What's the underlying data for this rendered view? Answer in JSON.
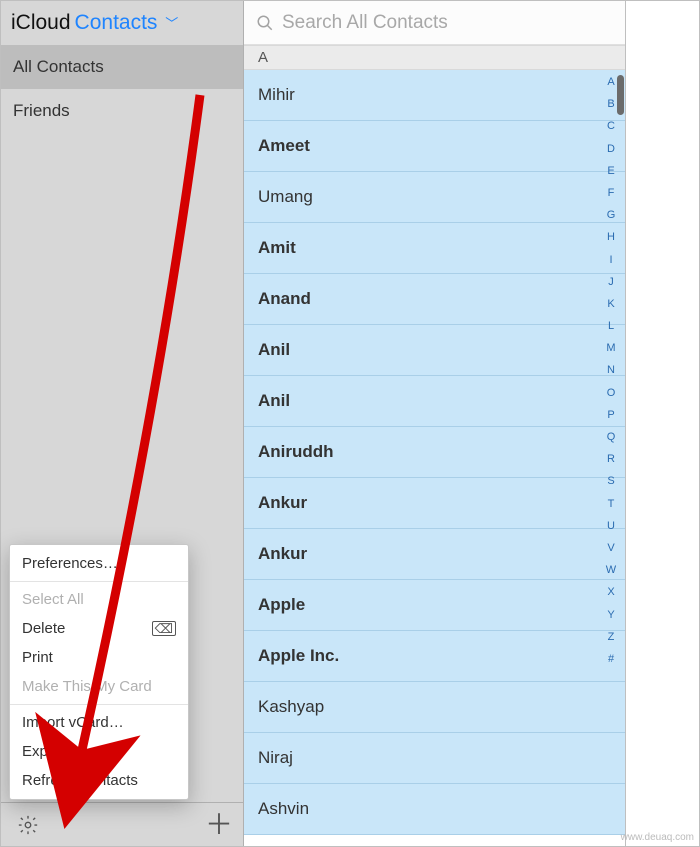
{
  "header": {
    "brand": "iCloud",
    "app_title": "Contacts"
  },
  "sidebar": {
    "groups": [
      {
        "label": "All Contacts",
        "active": true
      },
      {
        "label": "Friends",
        "active": false
      }
    ]
  },
  "search": {
    "placeholder": "Search All Contacts"
  },
  "section_letter": "A",
  "contacts": [
    {
      "name": "Mihir",
      "bold": false
    },
    {
      "name": "Ameet",
      "bold": true
    },
    {
      "name": "Umang",
      "bold": false
    },
    {
      "name": "Amit",
      "bold": true
    },
    {
      "name": "Anand",
      "bold": true
    },
    {
      "name": "Anil",
      "bold": true
    },
    {
      "name": "Anil",
      "bold": true
    },
    {
      "name": "Aniruddh",
      "bold": true
    },
    {
      "name": "Ankur",
      "bold": true
    },
    {
      "name": "Ankur",
      "bold": true
    },
    {
      "name": "Apple",
      "bold": true
    },
    {
      "name": "Apple Inc.",
      "bold": true
    },
    {
      "name": "Kashyap",
      "bold": false
    },
    {
      "name": "Niraj",
      "bold": false
    },
    {
      "name": "Ashvin",
      "bold": false
    }
  ],
  "index_letters": [
    "A",
    "B",
    "C",
    "D",
    "E",
    "F",
    "G",
    "H",
    "I",
    "J",
    "K",
    "L",
    "M",
    "N",
    "O",
    "P",
    "Q",
    "R",
    "S",
    "T",
    "U",
    "V",
    "W",
    "X",
    "Y",
    "Z",
    "#"
  ],
  "context_menu": {
    "preferences": "Preferences…",
    "select_all": "Select All",
    "delete": "Delete",
    "print": "Print",
    "make_my_card": "Make This My Card",
    "import_vcard": "Import vCard…",
    "export_vcard": "Export vCard…",
    "refresh": "Refresh Contacts"
  },
  "watermark": "www.deuaq.com"
}
